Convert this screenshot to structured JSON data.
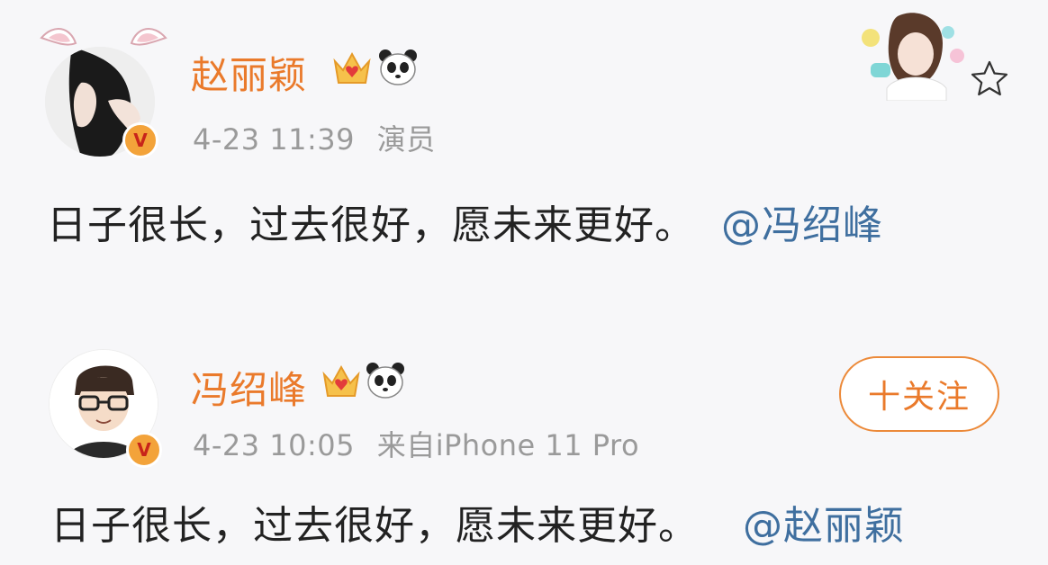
{
  "posts": [
    {
      "username": "赵丽颖",
      "timestamp": "4-23 11:39",
      "source": "演员",
      "content": "日子很长，过去很好，愿未来更好。",
      "mention": "@冯绍峰",
      "verified_mark": "V"
    },
    {
      "username": "冯绍峰",
      "timestamp": "4-23 10:05",
      "source": "来自iPhone 11 Pro",
      "content": "日子很长，过去很好，愿未来更好。",
      "mention": "@赵丽颖",
      "verified_mark": "V",
      "follow_label": "十关注"
    }
  ],
  "icons": {
    "crown": "crown-icon",
    "panda": "panda-icon",
    "star": "star-outline-icon",
    "verified": "verified-badge-icon"
  },
  "colors": {
    "username": "#ea7a2b",
    "meta": "#9a9a9a",
    "content": "#222222",
    "mention": "#3f6f9f",
    "verified": "#f3a33a"
  }
}
